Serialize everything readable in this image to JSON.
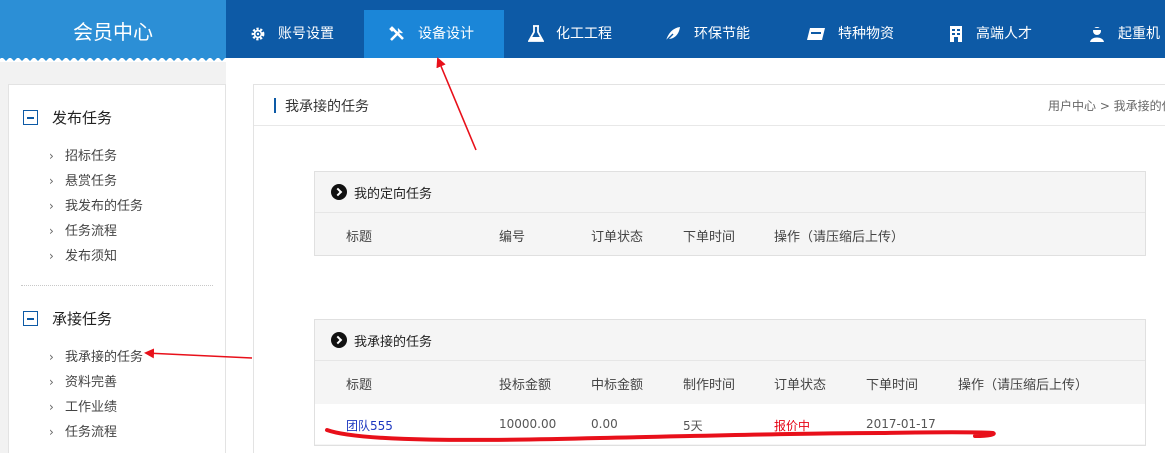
{
  "brand": {
    "title": "会员中心"
  },
  "nav": {
    "tabs": [
      {
        "label": "账号设置",
        "icon": "gear-icon"
      },
      {
        "label": "设备设计",
        "icon": "tools-icon"
      },
      {
        "label": "化工工程",
        "icon": "flask-icon"
      },
      {
        "label": "环保节能",
        "icon": "leaf-icon"
      },
      {
        "label": "特种物资",
        "icon": "card-icon"
      },
      {
        "label": "高端人才",
        "icon": "building-icon"
      },
      {
        "label": "起重机",
        "icon": "person-icon"
      }
    ],
    "active_index": 1
  },
  "sidebar": {
    "groups": [
      {
        "title": "发布任务",
        "items": [
          "招标任务",
          "悬赏任务",
          "我发布的任务",
          "任务流程",
          "发布须知"
        ]
      },
      {
        "title": "承接任务",
        "items": [
          "我承接的任务",
          "资料完善",
          "工作业绩",
          "任务流程"
        ]
      }
    ]
  },
  "main": {
    "title": "我承接的任务",
    "breadcrumb": "用户中心 > 我承接的任"
  },
  "directed_panel": {
    "title": "我的定向任务",
    "columns": [
      "标题",
      "编号",
      "订单状态",
      "下单时间",
      "操作（请压缩后上传）"
    ]
  },
  "accepted_panel": {
    "title": "我承接的任务",
    "columns": [
      "标题",
      "投标金额",
      "中标金额",
      "制作时间",
      "订单状态",
      "下单时间",
      "操作（请压缩后上传）"
    ],
    "rows": [
      {
        "title": "团队555",
        "bid_amount": "10000.00",
        "win_amount": "0.00",
        "duration": "5天",
        "status": "报价中",
        "order_date": "2017-01-17"
      }
    ]
  },
  "colors": {
    "nav_bg": "#0d5aa6",
    "brand_bg": "#2c8fd6",
    "active_tab": "#1b86d8",
    "status_red": "#e60012",
    "link_blue": "#1d38c0",
    "annotation_red": "#e8101a"
  }
}
